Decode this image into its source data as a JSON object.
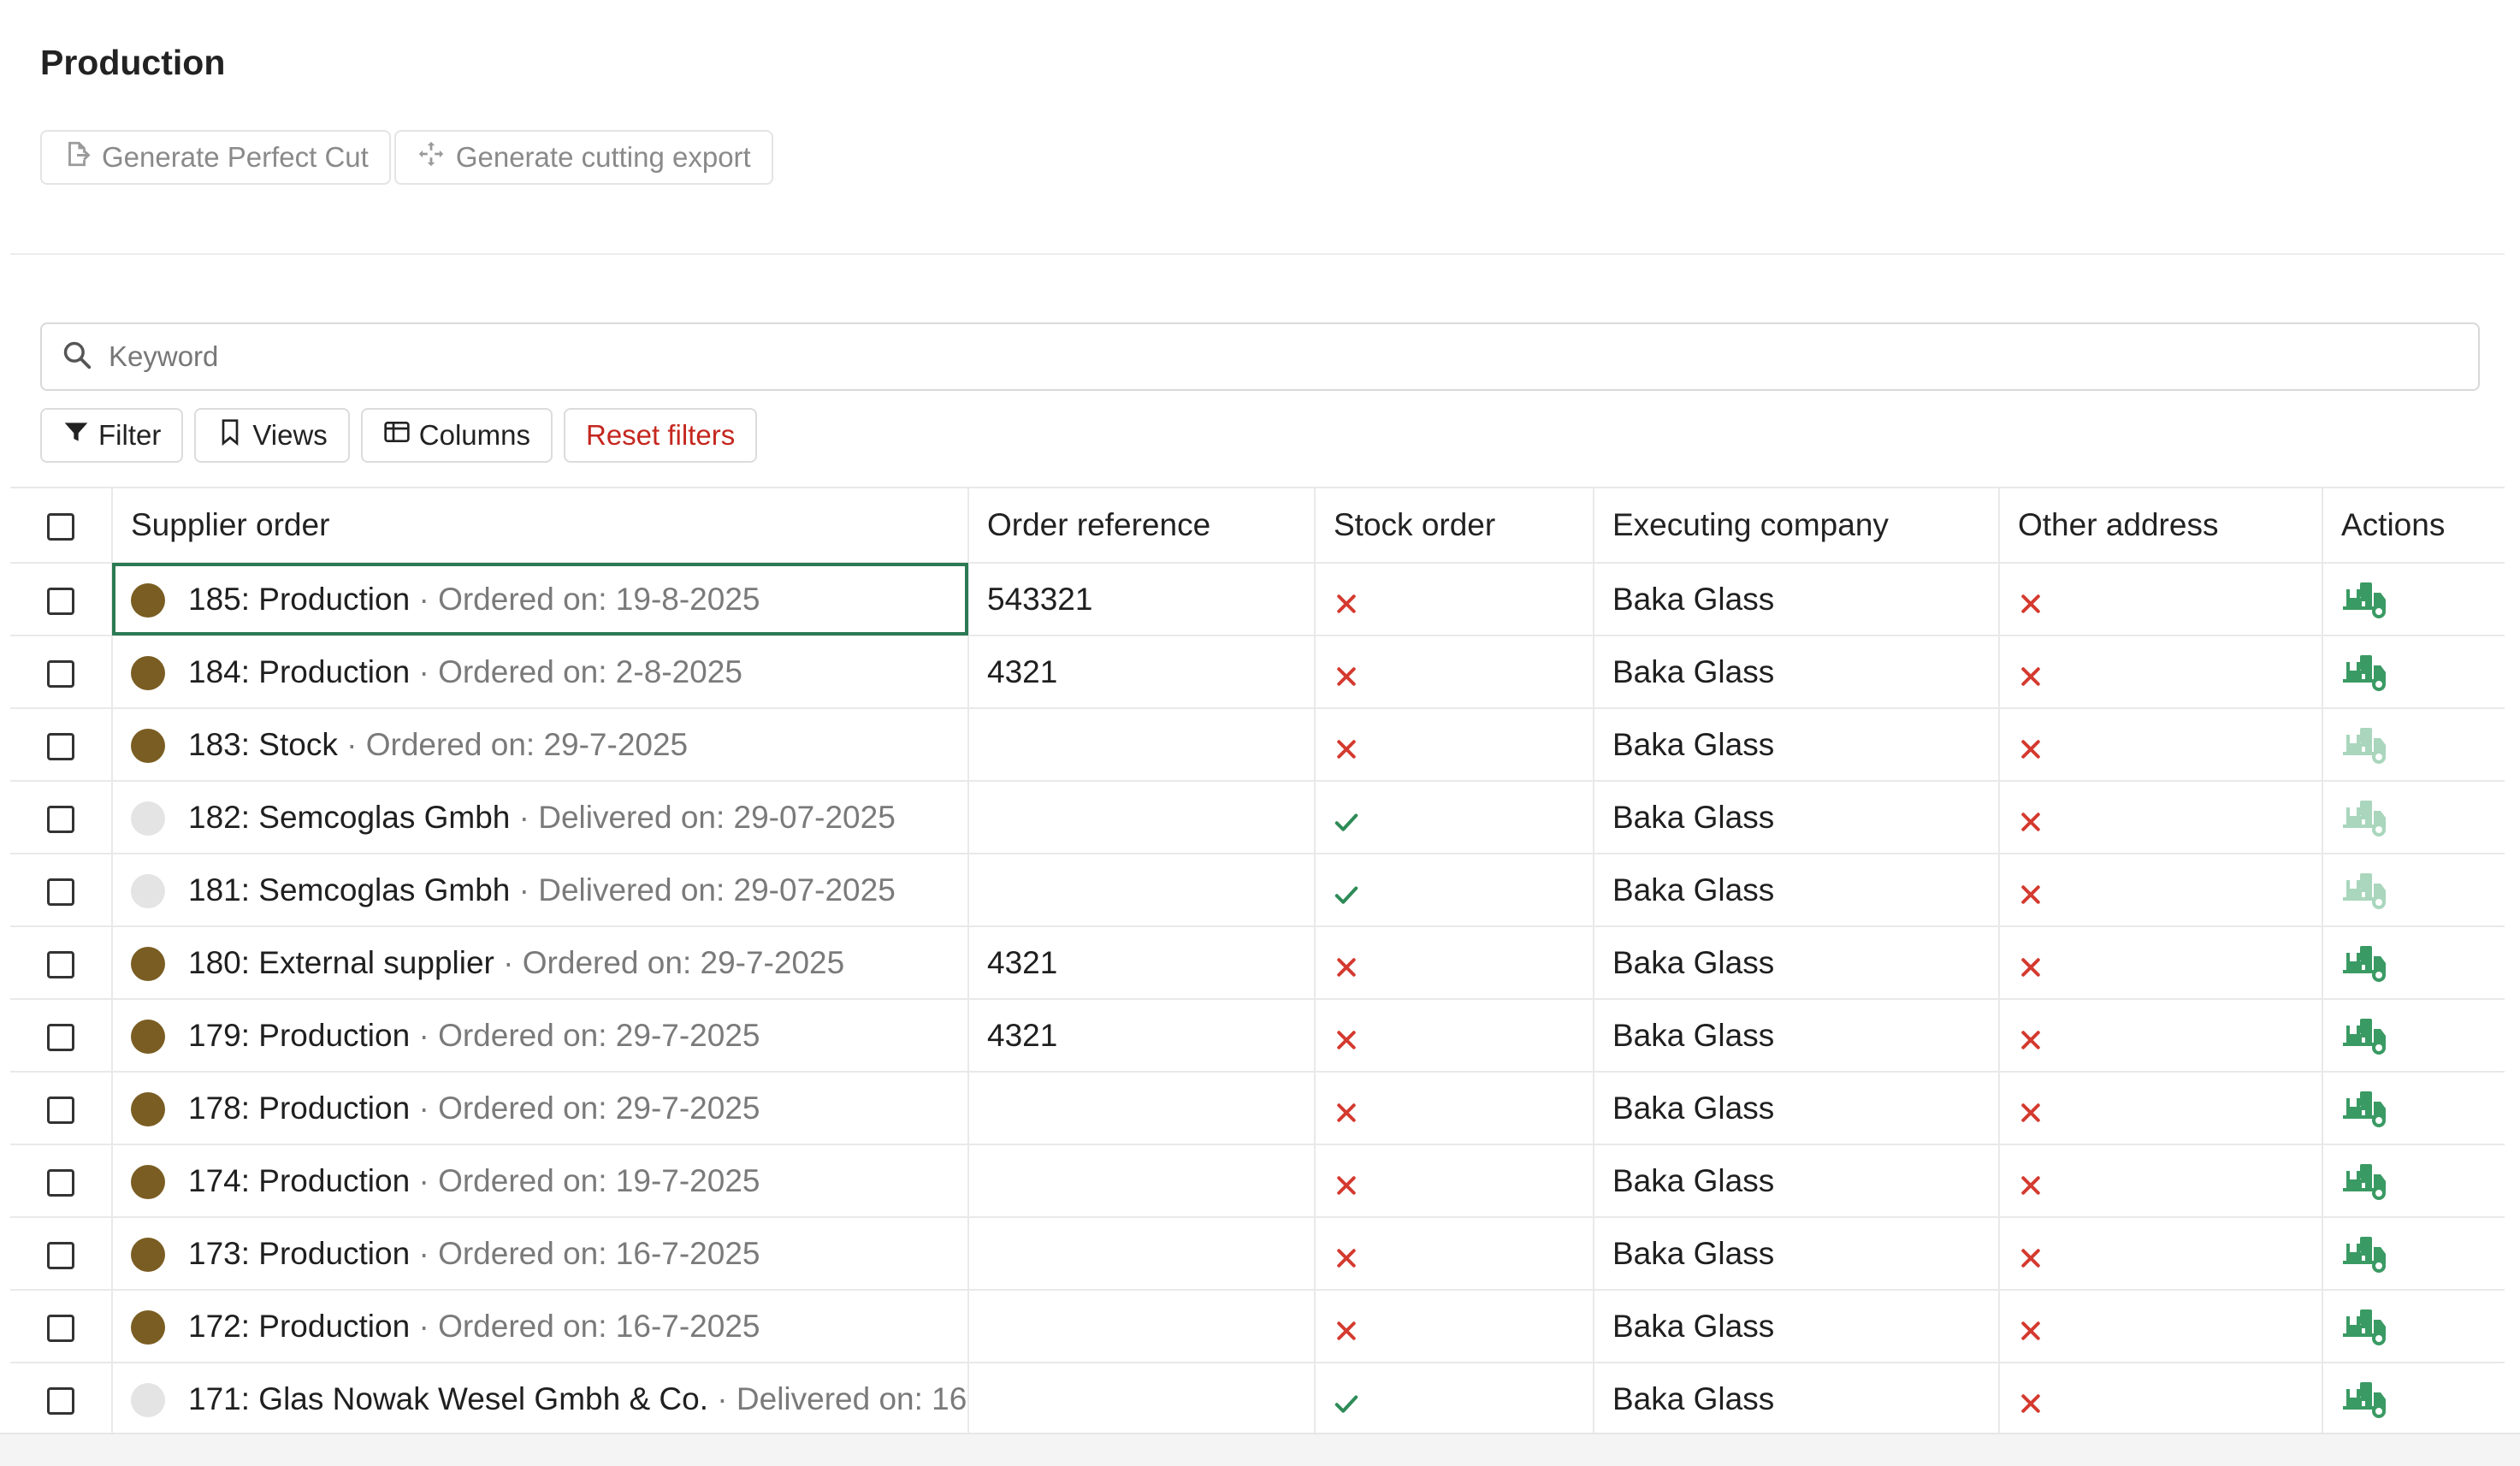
{
  "page": {
    "title": "Production"
  },
  "actions": [
    {
      "label": "Generate Perfect Cut",
      "icon": "file-export-icon"
    },
    {
      "label": "Generate cutting export",
      "icon": "arrows-move-icon"
    }
  ],
  "search": {
    "placeholder": "Keyword",
    "value": ""
  },
  "filters": {
    "filter_label": "Filter",
    "views_label": "Views",
    "columns_label": "Columns",
    "reset_label": "Reset filters"
  },
  "colors": {
    "accent": "#2b7a54",
    "status_dark": "#7a5d22",
    "status_light": "#e4e4e4",
    "cross": "#d43a2f",
    "check": "#2e8b57",
    "truck_active": "#3a9a63",
    "truck_disabled": "#a9d6bc",
    "reset": "#c4271f"
  },
  "table": {
    "columns": [
      "Supplier order",
      "Order reference",
      "Stock order",
      "Executing company",
      "Other address",
      "Actions"
    ],
    "rows": [
      {
        "status": "dark",
        "name": "185: Production",
        "date": "· Ordered on: 19-8-2025",
        "reference": "543321",
        "stock": false,
        "company": "Baka Glass",
        "other": false,
        "truck_enabled": true,
        "focused": true
      },
      {
        "status": "dark",
        "name": "184: Production",
        "date": "· Ordered on: 2-8-2025",
        "reference": "4321",
        "stock": false,
        "company": "Baka Glass",
        "other": false,
        "truck_enabled": true
      },
      {
        "status": "dark",
        "name": "183: Stock",
        "date": "· Ordered on: 29-7-2025",
        "reference": "",
        "stock": false,
        "company": "Baka Glass",
        "other": false,
        "truck_enabled": false
      },
      {
        "status": "light",
        "name": "182: Semcoglas Gmbh",
        "date": "· Delivered on: 29-07-2025",
        "reference": "",
        "stock": true,
        "company": "Baka Glass",
        "other": false,
        "truck_enabled": false
      },
      {
        "status": "light",
        "name": "181: Semcoglas Gmbh",
        "date": "· Delivered on: 29-07-2025",
        "reference": "",
        "stock": true,
        "company": "Baka Glass",
        "other": false,
        "truck_enabled": false
      },
      {
        "status": "dark",
        "name": "180: External supplier",
        "date": "· Ordered on: 29-7-2025",
        "reference": "4321",
        "stock": false,
        "company": "Baka Glass",
        "other": false,
        "truck_enabled": true
      },
      {
        "status": "dark",
        "name": "179: Production",
        "date": "· Ordered on: 29-7-2025",
        "reference": "4321",
        "stock": false,
        "company": "Baka Glass",
        "other": false,
        "truck_enabled": true
      },
      {
        "status": "dark",
        "name": "178: Production",
        "date": "· Ordered on: 29-7-2025",
        "reference": "",
        "stock": false,
        "company": "Baka Glass",
        "other": false,
        "truck_enabled": true
      },
      {
        "status": "dark",
        "name": "174: Production",
        "date": "· Ordered on: 19-7-2025",
        "reference": "",
        "stock": false,
        "company": "Baka Glass",
        "other": false,
        "truck_enabled": true
      },
      {
        "status": "dark",
        "name": "173: Production",
        "date": "· Ordered on: 16-7-2025",
        "reference": "",
        "stock": false,
        "company": "Baka Glass",
        "other": false,
        "truck_enabled": true
      },
      {
        "status": "dark",
        "name": "172: Production",
        "date": "· Ordered on: 16-7-2025",
        "reference": "",
        "stock": false,
        "company": "Baka Glass",
        "other": false,
        "truck_enabled": true
      },
      {
        "status": "light",
        "name": "171: Glas Nowak Wesel Gmbh & Co.",
        "date": "· Delivered on: 16-",
        "reference": "",
        "stock": true,
        "company": "Baka Glass",
        "other": false,
        "truck_enabled": true
      }
    ]
  }
}
